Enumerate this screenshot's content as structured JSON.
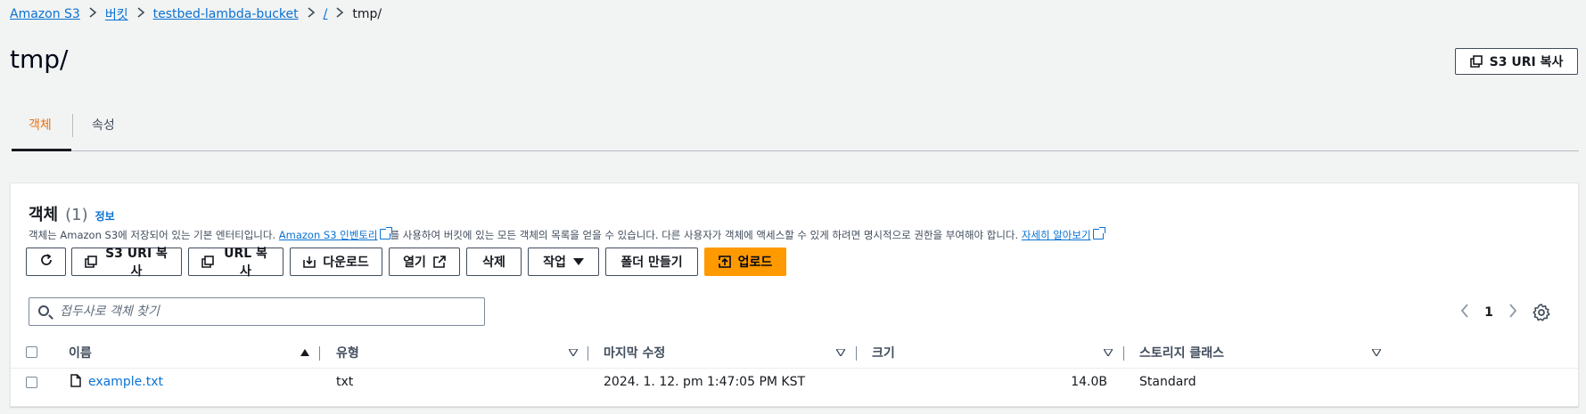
{
  "breadcrumb": {
    "items": [
      "Amazon S3",
      "버킷",
      "testbed-lambda-bucket",
      "/"
    ],
    "current": "tmp/"
  },
  "page": {
    "title": "tmp/",
    "copy_uri_label": "S3 URI 복사"
  },
  "tabs": {
    "objects": "객체",
    "properties": "속성",
    "active_color": "#ec7211"
  },
  "panel": {
    "title": "객체",
    "count": "(1)",
    "info": "정보",
    "desc_part1": "객체는 Amazon S3에 저장되어 있는 기본 엔터티입니다.",
    "desc_link1": "Amazon S3 인벤토리",
    "desc_part2": "를 사용하여 버킷에 있는 모든 객체의 목록을 얻을 수 있습니다. 다른 사용자가 객체에 액세스할 수 있게 하려면 명시적으로 권한을 부여해야 합니다.",
    "desc_link2": "자세히 알아보기"
  },
  "toolbar": {
    "refresh_icon": "refresh-icon",
    "copy_s3_uri": "S3 URI 복사",
    "copy_url": "URL 복사",
    "download": "다운로드",
    "open": "열기",
    "delete": "삭제",
    "actions": "작업",
    "create_folder": "폴더 만들기",
    "upload": "업로드",
    "primary_color": "#ff9900"
  },
  "search": {
    "placeholder": "접두사로 객체 찾기"
  },
  "pagination": {
    "page": "1"
  },
  "table": {
    "columns": [
      "이름",
      "유형",
      "마지막 수정",
      "크기",
      "스토리지 클래스"
    ],
    "rows": [
      {
        "name": "example.txt",
        "type": "txt",
        "modified": "2024. 1. 12. pm 1:47:05 PM KST",
        "size": "14.0B",
        "storage_class": "Standard"
      }
    ]
  }
}
